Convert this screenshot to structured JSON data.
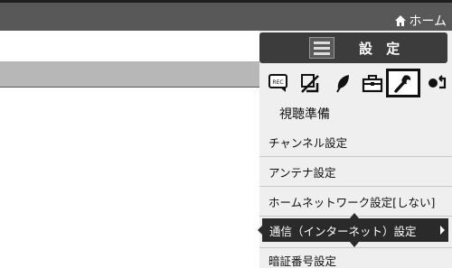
{
  "topbar": {
    "home_label": "ホーム",
    "home_icon": "home-icon"
  },
  "menu": {
    "title": "設 定",
    "header_icon": "settings-menu-icon",
    "categories": [
      {
        "icon": "rec-icon",
        "selected": false
      },
      {
        "icon": "wifi-off-icon",
        "selected": false
      },
      {
        "icon": "leaf-icon",
        "selected": false
      },
      {
        "icon": "toolbox-icon",
        "selected": false
      },
      {
        "icon": "wrench-icon",
        "selected": true
      },
      {
        "icon": "return-icon",
        "selected": false
      }
    ],
    "section_title": "視聴準備",
    "items": [
      {
        "label": "チャンネル設定"
      },
      {
        "label": "アンテナ設定"
      },
      {
        "label": "ホームネットワーク設定[しない]"
      },
      {
        "label": "通信（インターネット）設定",
        "selected": true
      },
      {
        "label": "暗証番号設定"
      }
    ]
  },
  "colors": {
    "topbar": "#585858",
    "selection": "#2a2a2a",
    "panel": "#efefef",
    "band": "#b7b7b7"
  }
}
